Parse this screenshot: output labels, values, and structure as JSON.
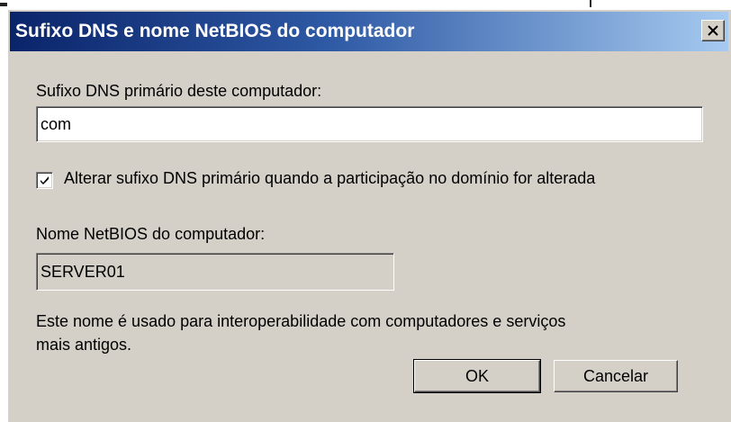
{
  "dialog": {
    "title": "Sufixo DNS e nome NetBIOS do computador",
    "close_icon": "close-icon"
  },
  "dns_suffix": {
    "label": "Sufixo DNS primário deste computador:",
    "value": "com"
  },
  "change_suffix": {
    "label": "Alterar sufixo DNS primário quando a participação no domínio for alterada",
    "checked": true
  },
  "netbios": {
    "label": "Nome NetBIOS do computador:",
    "value": "SERVER01"
  },
  "info_text": {
    "line1": "Este nome é usado para interoperabilidade com computadores e serviços",
    "line2": "mais antigos."
  },
  "buttons": {
    "ok": "OK",
    "cancel": "Cancelar"
  }
}
